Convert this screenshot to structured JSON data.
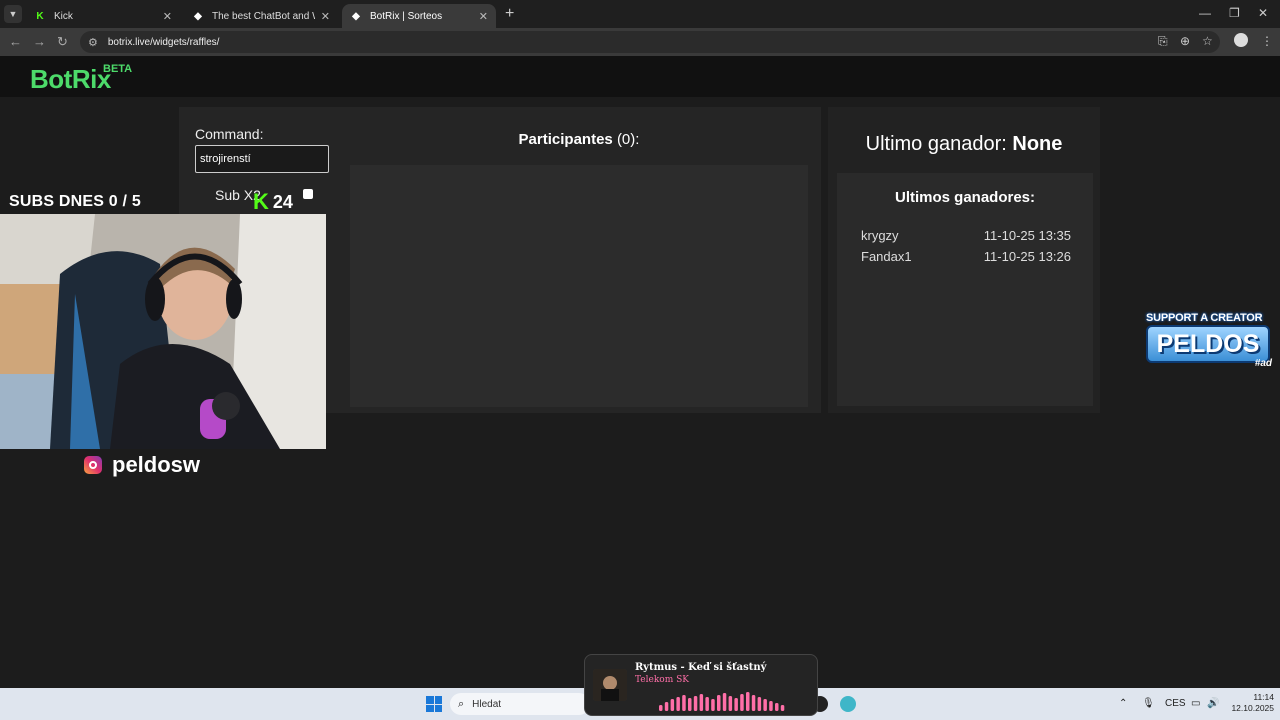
{
  "browser": {
    "tabs": [
      {
        "title": "Kick",
        "favicon": "kick-icon"
      },
      {
        "title": "The best ChatBot and Widgets",
        "favicon": "botrix-icon"
      },
      {
        "title": "BotRix | Sorteos",
        "favicon": "botrix-icon",
        "active": true
      }
    ],
    "url": "botrix.live/widgets/raffles/"
  },
  "header": {
    "logo": "BotRix",
    "badge": "BETA"
  },
  "raffle": {
    "command_label": "Command:",
    "command_value": "strojirenstí",
    "sub_label": "Sub X2",
    "participants_label": "Participantes",
    "participants_count": "(0):",
    "last_winner_label": "Ultimo ganador:",
    "last_winner_value": "None",
    "winners_title": "Ultimos ganadores:",
    "winners": [
      {
        "name": "krygzy",
        "date": "11-10-25 13:35"
      },
      {
        "name": "Fandax1",
        "date": "11-10-25 13:26"
      }
    ]
  },
  "overlay": {
    "subs_text": "SUBS DNES  0 / 5",
    "kick_count": "24",
    "instagram": "peldosw",
    "support_top": "SUPPORT A CREATOR",
    "support_main": "PELDOS",
    "support_tag": "#ad"
  },
  "media": {
    "song": "Rytmus - Keď si šťastný",
    "artist": "Telekom SK",
    "accent": "#ff6fa8"
  },
  "taskbar": {
    "search_placeholder": "Hledat",
    "lang": "CES",
    "time": "11:14",
    "date": "12.10.2025"
  }
}
